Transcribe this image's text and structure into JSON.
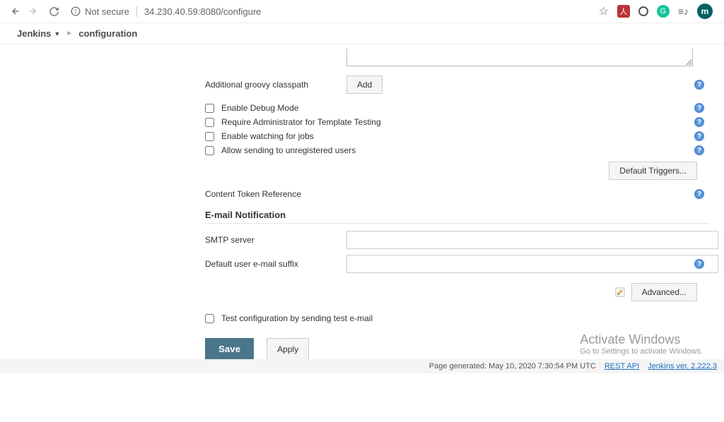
{
  "chrome": {
    "not_secure": "Not secure",
    "url": "34.230.40.59:8080/configure",
    "avatar_letter": "m"
  },
  "breadcrumb": {
    "app": "Jenkins",
    "page": "configuration"
  },
  "form": {
    "classpath_label": "Additional groovy classpath",
    "add_btn": "Add",
    "checkboxes": {
      "debug": "Enable Debug Mode",
      "require_admin": "Require Administrator for Template Testing",
      "watch_jobs": "Enable watching for jobs",
      "allow_unreg": "Allow sending to unregistered users"
    },
    "default_triggers": "Default Triggers...",
    "content_token": "Content Token Reference",
    "email_section": "E-mail Notification",
    "smtp_label": "SMTP server",
    "suffix_label": "Default user e-mail suffix",
    "advanced": "Advanced...",
    "test_email": "Test configuration by sending test e-mail",
    "save": "Save",
    "apply": "Apply"
  },
  "watermark": {
    "title": "Activate Windows",
    "sub": "Go to Settings to activate Windows."
  },
  "footer": {
    "generated": "Page generated: May 10, 2020 7:30:54 PM UTC",
    "rest_api": "REST API",
    "version": "Jenkins ver. 2.222.3"
  }
}
